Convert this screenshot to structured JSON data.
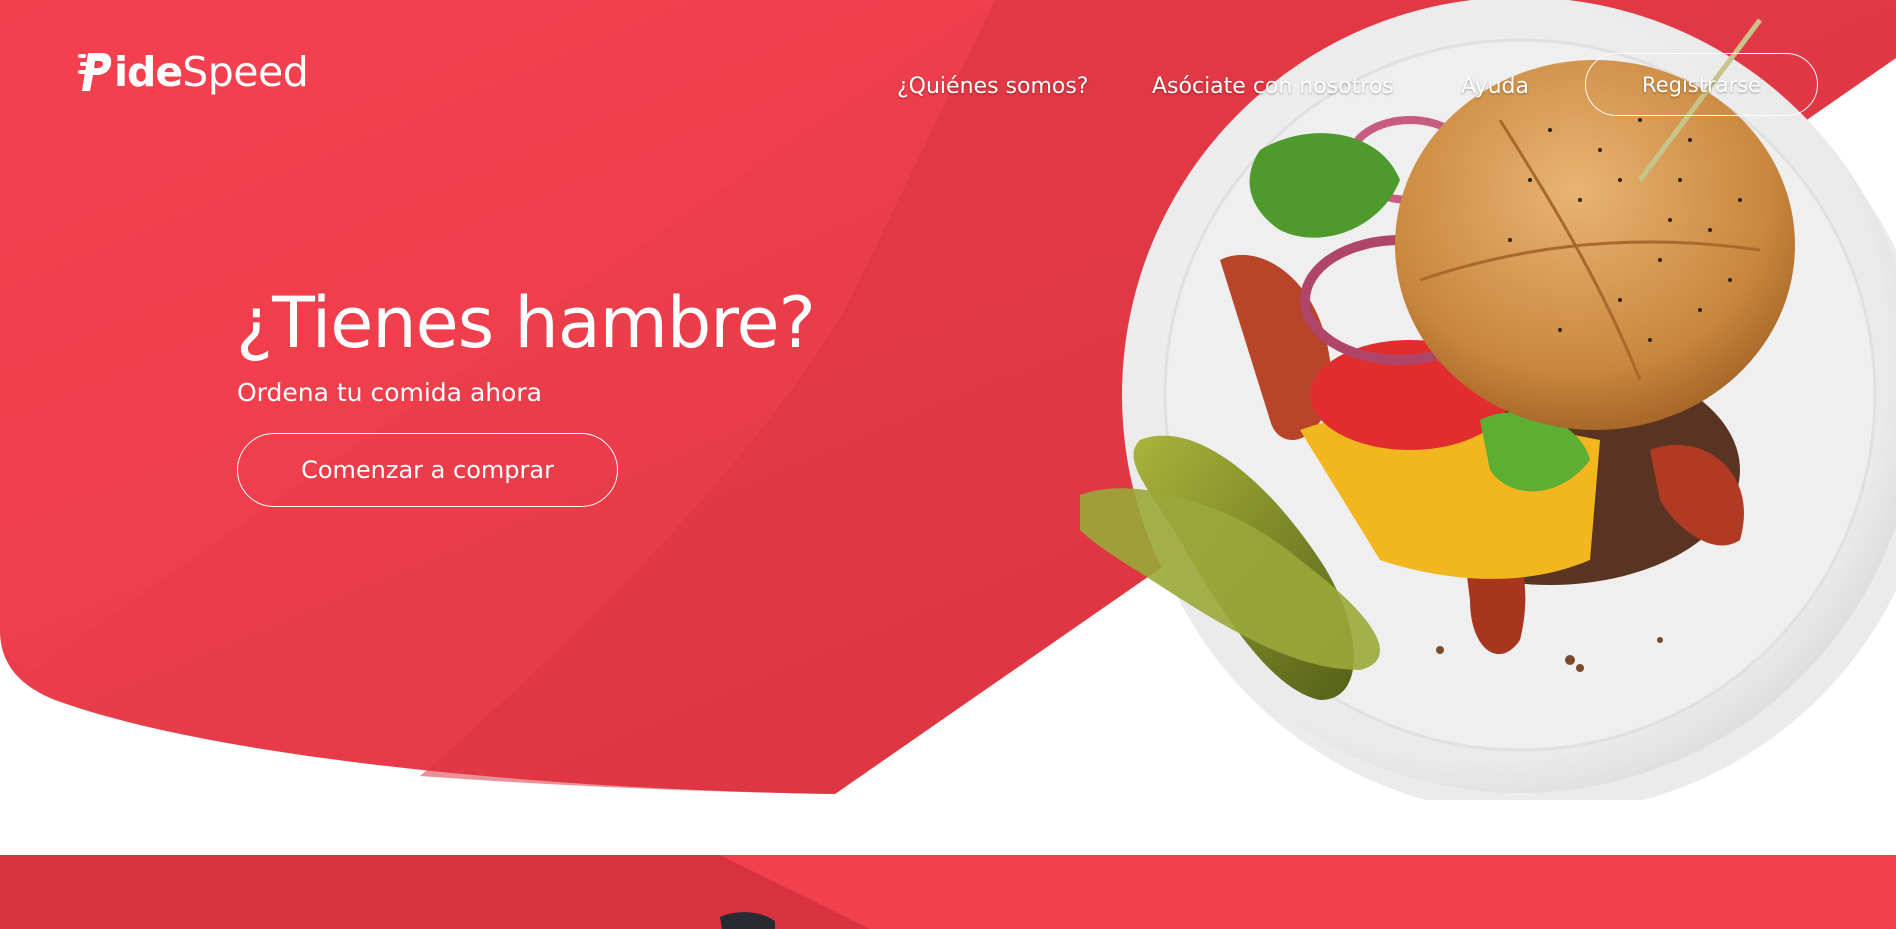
{
  "brand": {
    "name_bold": "ide",
    "name_light": "Speed",
    "mark_icon": "speed-p-logo-icon"
  },
  "nav": {
    "items": [
      {
        "label": "¿Quiénes somos?"
      },
      {
        "label": "Asóciate con nosotros"
      },
      {
        "label": "Ayuda"
      }
    ],
    "register_label": "Registrarse"
  },
  "hero": {
    "title": "¿Tienes hambre?",
    "subtitle": "Ordena tu comida ahora",
    "cta_label": "Comenzar a comprar",
    "image": "burger-plate-image"
  },
  "colors": {
    "brand_red": "#ee3d4a",
    "dark_red": "#d23542",
    "white": "#ffffff"
  }
}
